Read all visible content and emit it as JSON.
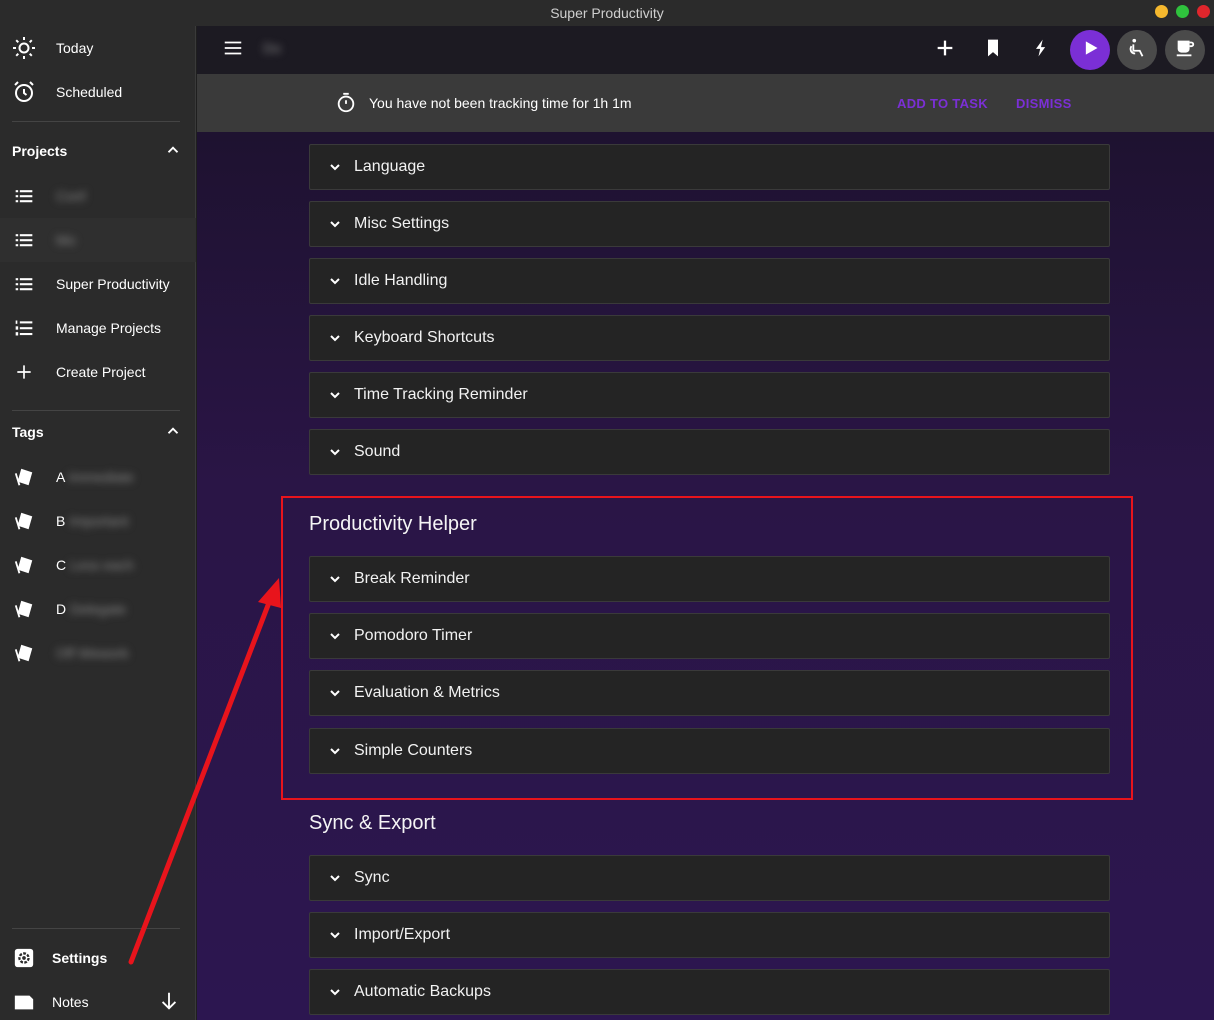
{
  "window": {
    "title": "Super Productivity",
    "buttons": {
      "minimize_color": "#f5b82e",
      "maximize_color": "#2fc23d",
      "close_color": "#e0262c"
    }
  },
  "sidebar": {
    "top_items": [
      {
        "label": "Today",
        "icon": "sun-icon"
      },
      {
        "label": "Scheduled",
        "icon": "alarm-clock-icon"
      }
    ],
    "projects": {
      "header": "Projects",
      "items": [
        {
          "label": "Conf",
          "icon": "list-icon",
          "blurred": true
        },
        {
          "label": "Mo",
          "icon": "list-icon",
          "blurred": true
        },
        {
          "label": "Super Productivity",
          "icon": "list-icon"
        },
        {
          "label": "Manage Projects",
          "icon": "list-numbered-icon"
        },
        {
          "label": "Create Project",
          "icon": "plus-icon"
        }
      ]
    },
    "tags": {
      "header": "Tags",
      "items": [
        {
          "prefix": "A",
          "label": "Immediate",
          "icon": "tags-icon"
        },
        {
          "prefix": "B",
          "label": "Important",
          "icon": "tags-icon"
        },
        {
          "prefix": "C",
          "label": "Less each",
          "icon": "tags-icon"
        },
        {
          "prefix": "D",
          "label": "Delegate",
          "icon": "tags-icon"
        },
        {
          "prefix": "",
          "label": "Off Wework",
          "icon": "tags-icon"
        }
      ]
    },
    "bottom": {
      "settings_label": "Settings",
      "notes_label": "Notes"
    }
  },
  "topbar": {
    "current_context": "Do",
    "accent_color": "#7b2fd6"
  },
  "banner": {
    "message": "You have not been tracking time for 1h 1m",
    "add_to_task": "ADD TO TASK",
    "dismiss": "DISMISS"
  },
  "settings": {
    "general_panels": [
      "Language",
      "Misc Settings",
      "Idle Handling",
      "Keyboard Shortcuts",
      "Time Tracking Reminder",
      "Sound"
    ],
    "productivity_helper": {
      "title": "Productivity Helper",
      "panels": [
        "Break Reminder",
        "Pomodoro Timer",
        "Evaluation & Metrics",
        "Simple Counters"
      ]
    },
    "sync_export": {
      "title": "Sync & Export",
      "panels": [
        "Sync",
        "Import/Export",
        "Automatic Backups"
      ]
    }
  },
  "annotation": {
    "highlight_color": "#e8141c"
  }
}
